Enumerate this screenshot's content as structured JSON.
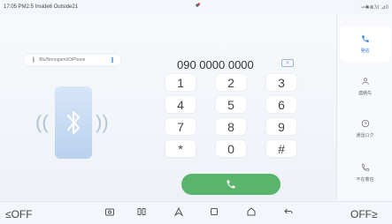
{
  "status_bar": {
    "left_text": "17:05 PM2.5 Inside6 Outside21",
    "right_text": "⊸✱⊗ℳ ⊿0"
  },
  "bluetooth": {
    "device_name": "Blu/Nonogami/OiPhone"
  },
  "dialer": {
    "number": "090 0000 0000",
    "country": "日本",
    "keys": [
      "1",
      "2",
      "3",
      "4",
      "5",
      "6",
      "7",
      "8",
      "9",
      "*",
      "0",
      "#"
    ]
  },
  "sidebar": {
    "items": [
      {
        "label": "発信",
        "icon": "phone-icon"
      },
      {
        "label": "連絡先",
        "icon": "contacts-icon"
      },
      {
        "label": "通話ログ",
        "icon": "clock-icon"
      },
      {
        "label": "不在着信",
        "icon": "missed-call-icon"
      }
    ]
  },
  "bottom_bar": {
    "left_label": "OFF",
    "right_label": "OFF"
  },
  "colors": {
    "accent": "#2d7fe0",
    "call_green": "#59b56b",
    "background": "#f3f6fa"
  }
}
